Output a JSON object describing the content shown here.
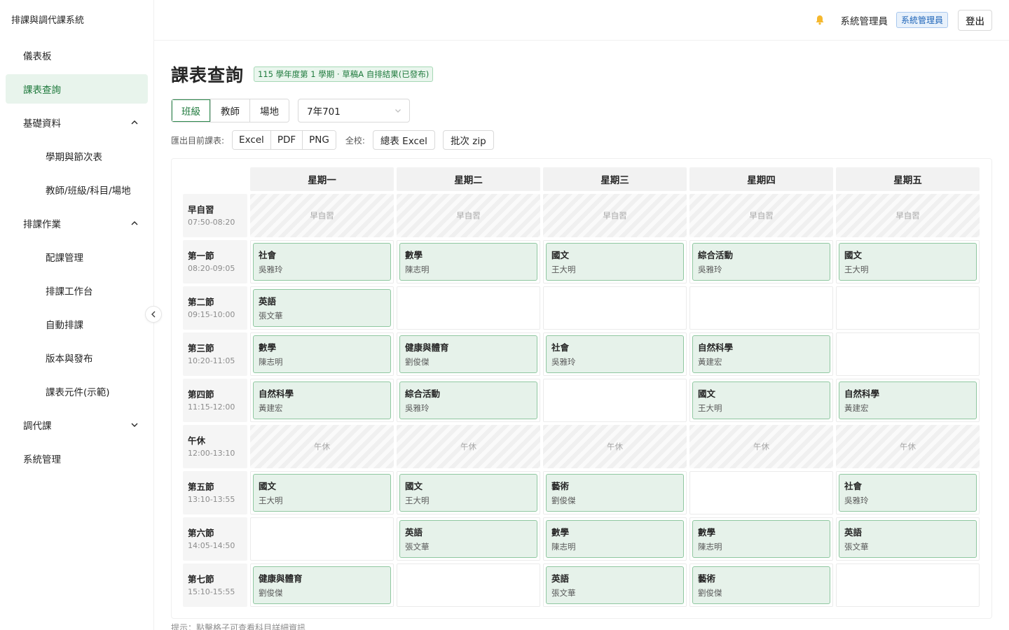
{
  "app": {
    "title": "排課與調代課系統"
  },
  "sidebar": {
    "items": [
      {
        "label": "儀表板"
      },
      {
        "label": "課表查詢"
      },
      {
        "label": "基礎資料"
      },
      {
        "label": "學期與節次表"
      },
      {
        "label": "教師/班級/科目/場地"
      },
      {
        "label": "排課作業"
      },
      {
        "label": "配課管理"
      },
      {
        "label": "排課工作台"
      },
      {
        "label": "自動排課"
      },
      {
        "label": "版本與發布"
      },
      {
        "label": "課表元件(示範)"
      },
      {
        "label": "調代課"
      },
      {
        "label": "系統管理"
      }
    ]
  },
  "topbar": {
    "user_name": "系統管理員",
    "role": "系統管理員",
    "logout": "登出"
  },
  "page": {
    "title": "課表查詢",
    "term_tag": "115 學年度第 1 學期 · 草稿A 自排結果(已發布)",
    "view_tabs": [
      "班級",
      "教師",
      "場地"
    ],
    "selected_class": "7年701",
    "export_label": "匯出目前課表:",
    "export_buttons": [
      "Excel",
      "PDF",
      "PNG"
    ],
    "school_label": "全校:",
    "school_excel": "總表 Excel",
    "batch_zip": "批次 zip",
    "footnote": "提示：點擊格子可查看科目詳細資訊"
  },
  "timetable": {
    "days": [
      "星期一",
      "星期二",
      "星期三",
      "星期四",
      "星期五"
    ],
    "periods": [
      {
        "name": "早自習",
        "time": "07:50-08:20",
        "block": "早自習"
      },
      {
        "name": "第一節",
        "time": "08:20-09:05",
        "cells": [
          {
            "subject": "社會",
            "teacher": "吳雅玲"
          },
          {
            "subject": "數學",
            "teacher": "陳志明"
          },
          {
            "subject": "國文",
            "teacher": "王大明"
          },
          {
            "subject": "綜合活動",
            "teacher": "吳雅玲"
          },
          {
            "subject": "國文",
            "teacher": "王大明"
          }
        ]
      },
      {
        "name": "第二節",
        "time": "09:15-10:00",
        "cells": [
          {
            "subject": "英語",
            "teacher": "張文華"
          },
          null,
          null,
          null,
          null
        ]
      },
      {
        "name": "第三節",
        "time": "10:20-11:05",
        "cells": [
          {
            "subject": "數學",
            "teacher": "陳志明"
          },
          {
            "subject": "健康與體育",
            "teacher": "劉俊傑"
          },
          {
            "subject": "社會",
            "teacher": "吳雅玲"
          },
          {
            "subject": "自然科學",
            "teacher": "黃建宏"
          },
          null
        ]
      },
      {
        "name": "第四節",
        "time": "11:15-12:00",
        "cells": [
          {
            "subject": "自然科學",
            "teacher": "黃建宏"
          },
          {
            "subject": "綜合活動",
            "teacher": "吳雅玲"
          },
          null,
          {
            "subject": "國文",
            "teacher": "王大明"
          },
          {
            "subject": "自然科學",
            "teacher": "黃建宏"
          }
        ]
      },
      {
        "name": "午休",
        "time": "12:00-13:10",
        "block": "午休"
      },
      {
        "name": "第五節",
        "time": "13:10-13:55",
        "cells": [
          {
            "subject": "國文",
            "teacher": "王大明"
          },
          {
            "subject": "國文",
            "teacher": "王大明"
          },
          {
            "subject": "藝術",
            "teacher": "劉俊傑"
          },
          null,
          {
            "subject": "社會",
            "teacher": "吳雅玲"
          }
        ]
      },
      {
        "name": "第六節",
        "time": "14:05-14:50",
        "cells": [
          null,
          {
            "subject": "英語",
            "teacher": "張文華"
          },
          {
            "subject": "數學",
            "teacher": "陳志明"
          },
          {
            "subject": "數學",
            "teacher": "陳志明"
          },
          {
            "subject": "英語",
            "teacher": "張文華"
          }
        ]
      },
      {
        "name": "第七節",
        "time": "15:10-15:55",
        "cells": [
          {
            "subject": "健康與體育",
            "teacher": "劉俊傑"
          },
          null,
          {
            "subject": "英語",
            "teacher": "張文華"
          },
          {
            "subject": "藝術",
            "teacher": "劉俊傑"
          },
          null
        ]
      }
    ]
  },
  "colors": {
    "accent": "#1f7a3d",
    "lesson_bg": "#e6f2ea",
    "lesson_border": "#8fc7a0",
    "role_badge": "#1d64b8"
  },
  "icons": {
    "bell": "bell-icon",
    "collapse": "chevron-left-icon",
    "expand": "chevron-up-icon",
    "dropdown": "chevron-down-icon"
  }
}
